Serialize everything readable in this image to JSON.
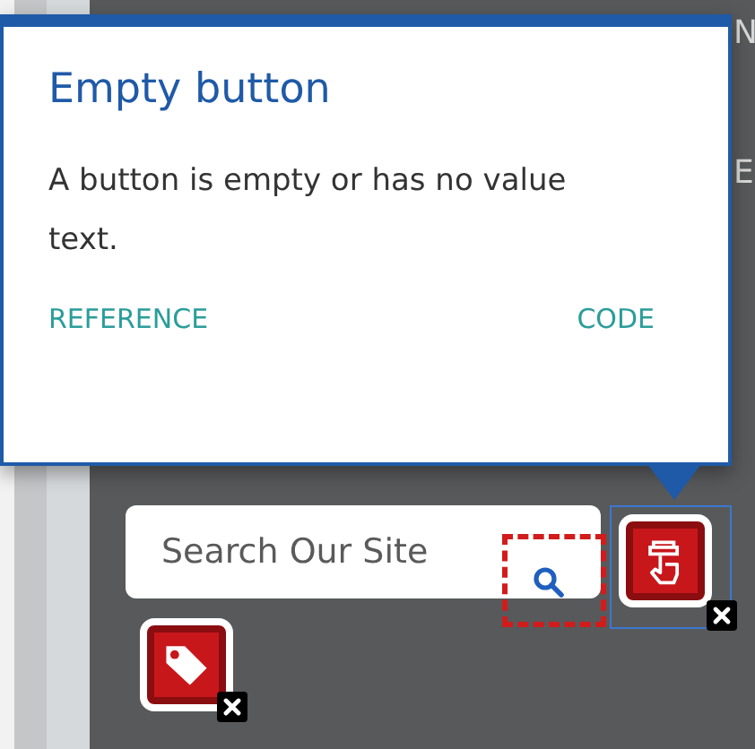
{
  "page": {
    "edge_texts": [
      "N",
      "E"
    ],
    "search": {
      "placeholder": "Search Our Site"
    }
  },
  "flags": [
    {
      "kind": "hand",
      "selected": true
    },
    {
      "kind": "tag",
      "selected": false
    }
  ],
  "popup": {
    "title": "Empty button",
    "description": "A button is empty or has no value text.",
    "links": [
      "REFERENCE",
      "CODE"
    ]
  }
}
